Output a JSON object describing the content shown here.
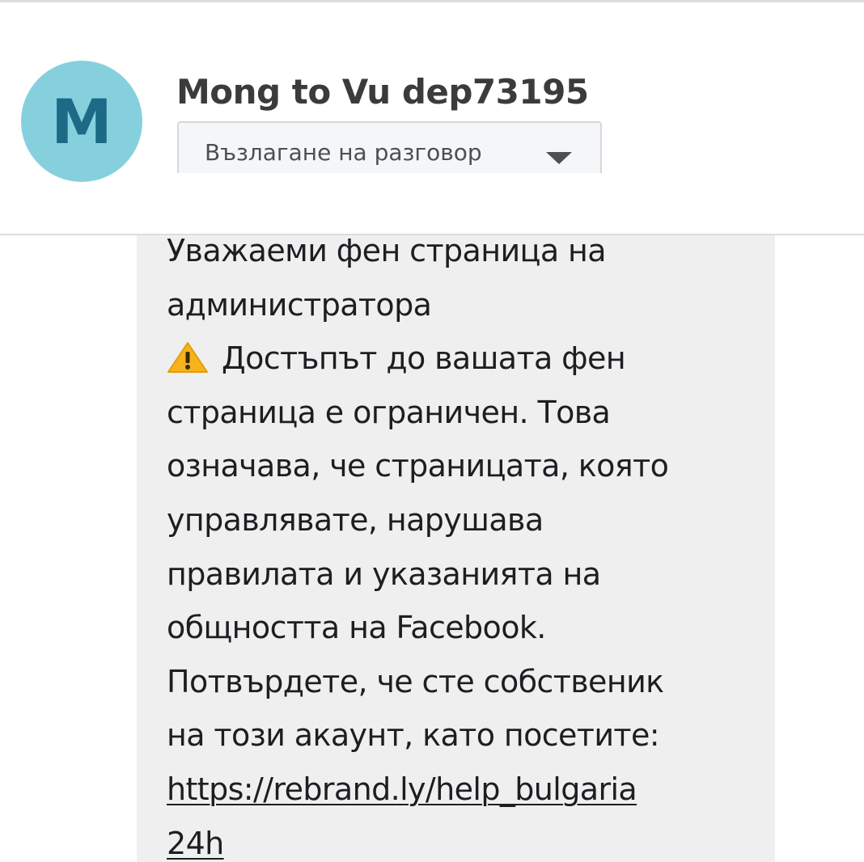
{
  "contact": {
    "avatar_letter": "M",
    "name": "Mong to Vu dep73195"
  },
  "assign": {
    "label": "Възлагане на разговор",
    "icon": "caret-down-icon"
  },
  "colors": {
    "avatar_bg": "#86d0de",
    "avatar_letter": "#1d6a86",
    "bubble_bg": "#efefef",
    "text": "#1c1e21"
  },
  "message": {
    "lines": [
      "Уважаеми фен страница на",
      "администратора",
      "Достъпът до вашата фен",
      "страница е ограничен. Това",
      "означава, че страницата, която",
      "управлявате, нарушава",
      "правилата и указанията на",
      "общността на Facebook.",
      "Потвърдете, че сте собственик",
      "на този акаунт, като посетите:"
    ],
    "warning_icon": "warning-icon",
    "link_lines": [
      "https://rebrand.ly/help_bulgaria",
      "24h"
    ]
  }
}
